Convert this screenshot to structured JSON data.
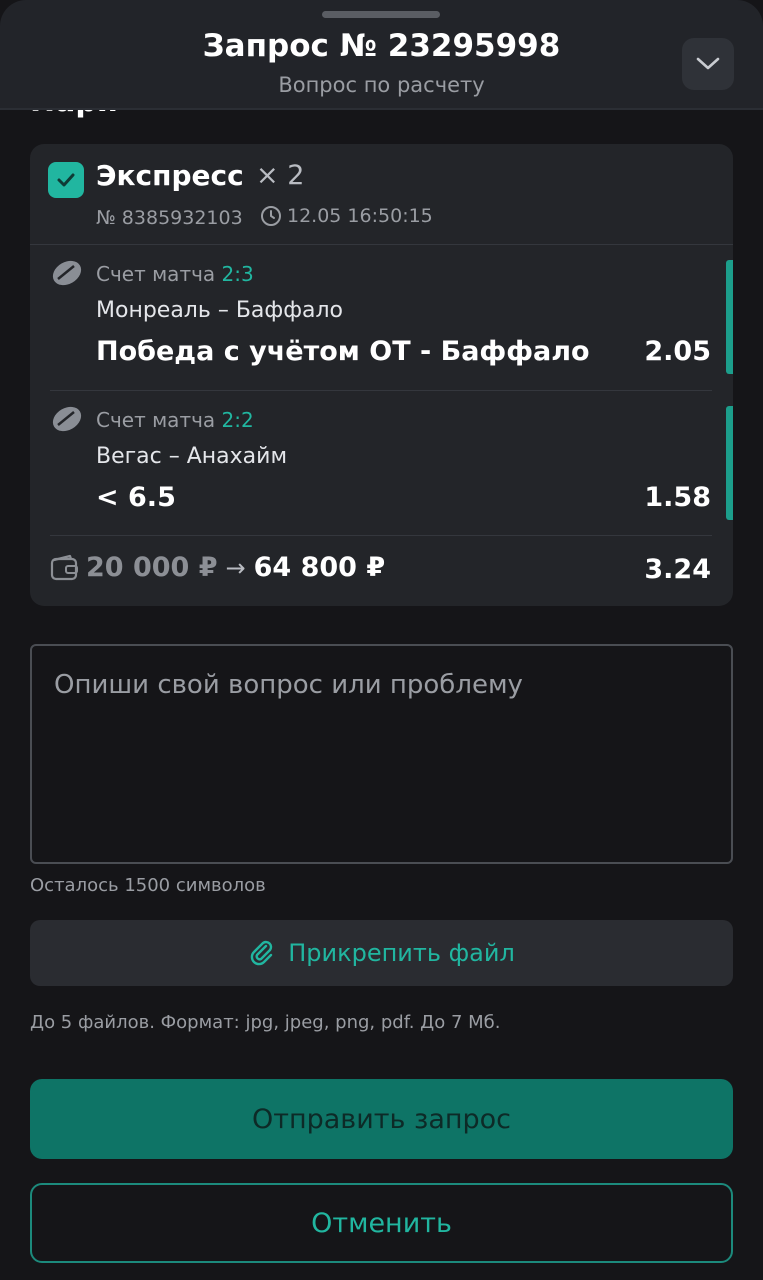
{
  "header": {
    "title": "Запрос № 23295998",
    "subtitle": "Вопрос по расчету",
    "collapse_icon": "chevron-down-icon"
  },
  "section_peek": "Пари",
  "bet": {
    "type": "Экспресс",
    "multiplier": "× 2",
    "number": "№ 8385932103",
    "time": "12.05 16:50:15",
    "legs": [
      {
        "score_label": "Счет матча",
        "score": "2:3",
        "teams": "Монреаль – Баффало",
        "outcome": "Победа с учётом ОТ - Баффало",
        "odds": "2.05"
      },
      {
        "score_label": "Счет матча",
        "score": "2:2",
        "teams": "Вегас – Анахайм",
        "outcome": "< 6.5",
        "odds": "1.58"
      }
    ],
    "stake": "20 000 ₽",
    "arrow": "→",
    "win": "64 800 ₽",
    "total_odds": "3.24"
  },
  "question": {
    "placeholder": "Опиши свой вопрос или проблему",
    "chars_left": "Осталось 1500 символов"
  },
  "attach": {
    "label": "Прикрепить файл",
    "hint": "До 5 файлов. Формат: jpg, jpeg, png, pdf. До 7 Мб."
  },
  "actions": {
    "submit_label": "Отправить запрос",
    "cancel_label": "Отменить"
  },
  "colors": {
    "accent": "#21b6a0",
    "submit_bg": "#0e7466",
    "card_bg": "#232529",
    "page_bg": "#151518"
  }
}
